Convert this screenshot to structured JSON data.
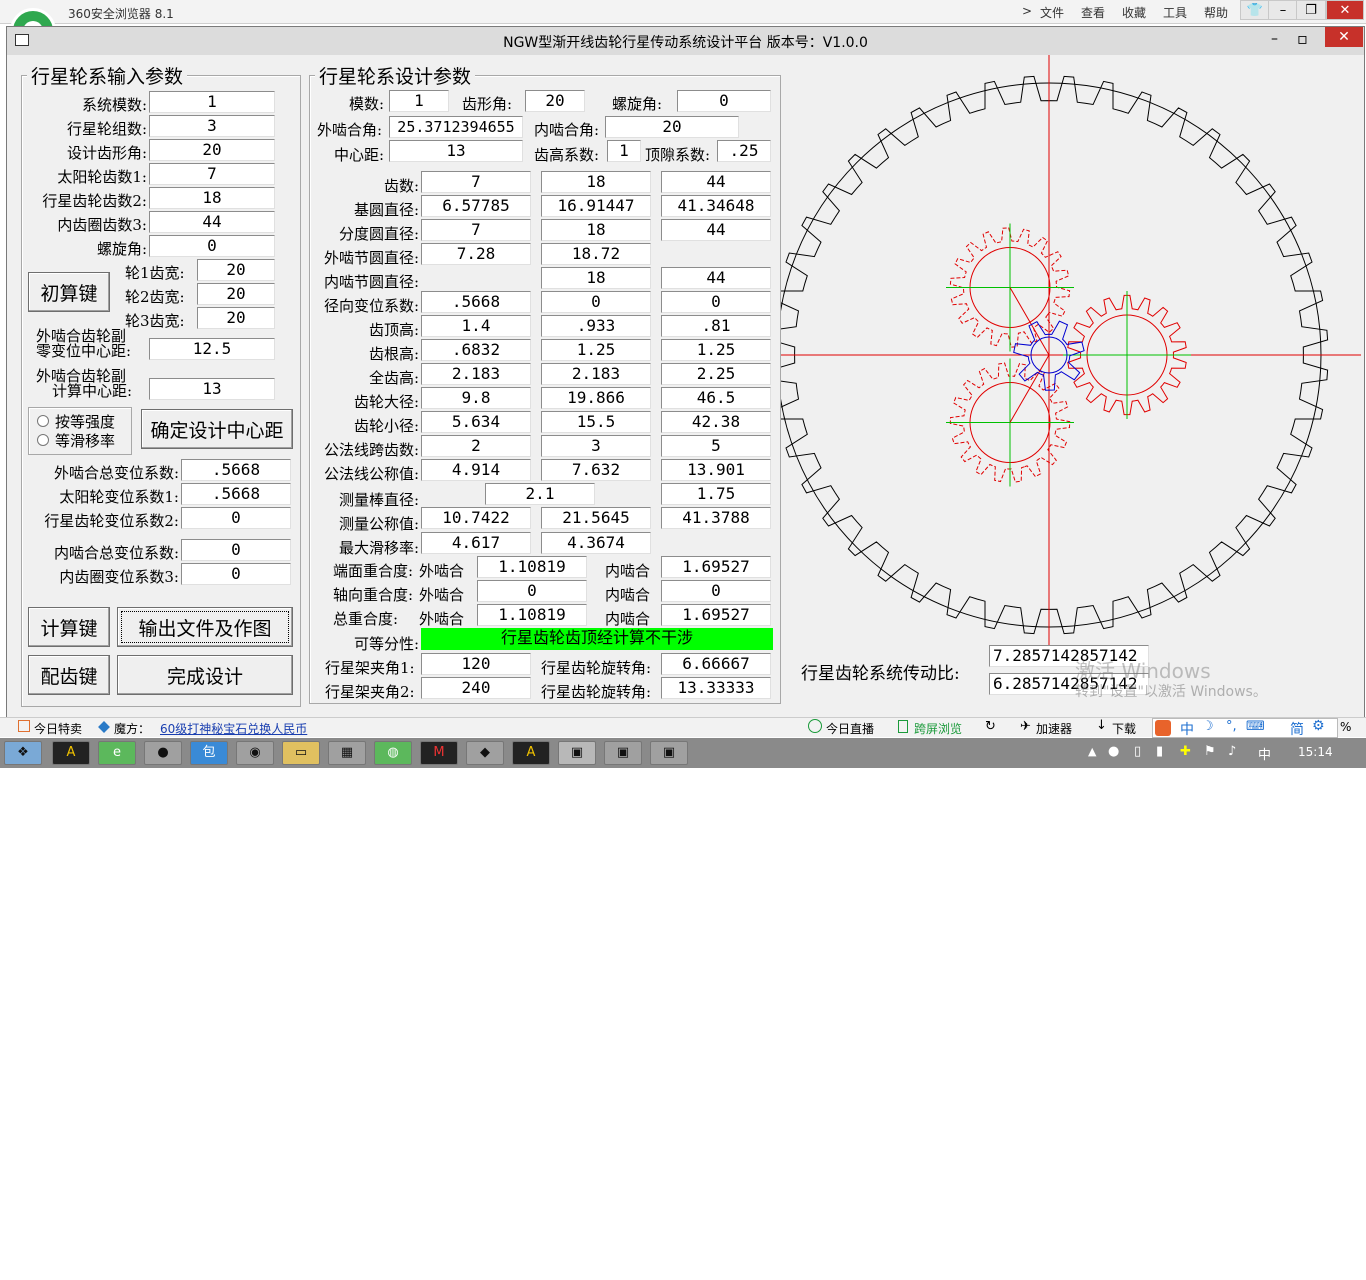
{
  "browser": {
    "title": "360安全浏览器 8.1",
    "menu": [
      "文件",
      "查看",
      "收藏",
      "工具",
      "帮助"
    ],
    "chevron": ">"
  },
  "window": {
    "title": "NGW型渐开线齿轮行星传动系统设计平台   版本号：V1.0.0",
    "min": "–",
    "max": "▫",
    "close": "✕"
  },
  "input_panel": {
    "title": "行星轮系输入参数",
    "rows": [
      {
        "label": "系统模数:",
        "value": "1"
      },
      {
        "label": "行星轮组数:",
        "value": "3"
      },
      {
        "label": "设计齿形角:",
        "value": "20"
      },
      {
        "label": "太阳轮齿数1:",
        "value": "7"
      },
      {
        "label": "行星齿轮齿数2:",
        "value": "18"
      },
      {
        "label": "内齿圈齿数3:",
        "value": "44"
      },
      {
        "label": "螺旋角:",
        "value": "0"
      }
    ],
    "initial_calc_button": "初算键",
    "widths": [
      {
        "label": "轮1齿宽:",
        "value": "20"
      },
      {
        "label": "轮2齿宽:",
        "value": "20"
      },
      {
        "label": "轮3齿宽:",
        "value": "20"
      }
    ],
    "zero_shift_label_1": "外啮合齿轮副",
    "zero_shift_label_2": "零变位中心距:",
    "zero_shift_value": "12.5",
    "calc_center_label_1": "外啮合齿轮副",
    "calc_center_label_2": "计算中心距:",
    "calc_center_value": "13",
    "radio_equal_strength": "按等强度",
    "radio_equal_slip": "等滑移率",
    "confirm_center_button": "确定设计中心距",
    "shift_rows": [
      {
        "label": "外啮合总变位系数:",
        "value": ".5668"
      },
      {
        "label": "太阳轮变位系数1:",
        "value": ".5668"
      },
      {
        "label": "行星齿轮变位系数2:",
        "value": "0"
      }
    ],
    "inner_rows": [
      {
        "label": "内啮合总变位系数:",
        "value": "0"
      },
      {
        "label": "内齿圈变位系数3:",
        "value": "0"
      }
    ],
    "calc_button": "计算键",
    "output_button": "输出文件及作图",
    "match_button": "配齿键",
    "finish_button": "完成设计"
  },
  "design_panel": {
    "title": "行星轮系设计参数",
    "module_label": "模数:",
    "module": "1",
    "profile_angle_label": "齿形角:",
    "profile_angle": "20",
    "helix_label": "螺旋角:",
    "helix": "0",
    "ext_mesh_angle_label": "外啮合角:",
    "ext_mesh_angle": "25.3712394655",
    "int_mesh_angle_label": "内啮合角:",
    "int_mesh_angle": "20",
    "center_label": "中心距:",
    "center": "13",
    "addendum_coef_label": "齿高系数:",
    "addendum_coef": "1",
    "clearance_label": "顶隙系数:",
    "clearance": ".25",
    "table": [
      {
        "label": "齿数:",
        "v": [
          "7",
          "18",
          "44"
        ]
      },
      {
        "label": "基圆直径:",
        "v": [
          "6.57785",
          "16.91447",
          "41.34648"
        ]
      },
      {
        "label": "分度圆直径:",
        "v": [
          "7",
          "18",
          "44"
        ]
      },
      {
        "label": "外啮节圆直径:",
        "v": [
          "7.28",
          "18.72",
          ""
        ]
      },
      {
        "label": "内啮节圆直径:",
        "v": [
          "",
          "18",
          "44"
        ]
      },
      {
        "label": "径向变位系数:",
        "v": [
          ".5668",
          "0",
          "0"
        ]
      },
      {
        "label": "齿顶高:",
        "v": [
          "1.4",
          ".933",
          ".81"
        ]
      },
      {
        "label": "齿根高:",
        "v": [
          ".6832",
          "1.25",
          "1.25"
        ]
      },
      {
        "label": "全齿高:",
        "v": [
          "2.183",
          "2.183",
          "2.25"
        ]
      },
      {
        "label": "齿轮大径:",
        "v": [
          "9.8",
          "19.866",
          "46.5"
        ]
      },
      {
        "label": "齿轮小径:",
        "v": [
          "5.634",
          "15.5",
          "42.38"
        ]
      },
      {
        "label": "公法线跨齿数:",
        "v": [
          "2",
          "3",
          "5"
        ]
      },
      {
        "label": "公法线公称值:",
        "v": [
          "4.914",
          "7.632",
          "13.901"
        ]
      }
    ],
    "rod_label": "测量棒直径:",
    "rod_12": "2.1",
    "rod_3": "1.75",
    "measure_label": "测量公称值:",
    "measure": [
      "10.7422",
      "21.5645",
      "41.3788"
    ],
    "slip_label": "最大滑移率:",
    "slip": [
      "4.617",
      "4.3674"
    ],
    "contact_rows": [
      {
        "label": "端面重合度:",
        "ext": "外啮合",
        "ext_v": "1.10819",
        "int": "内啮合",
        "int_v": "1.69527"
      },
      {
        "label": "轴向重合度:",
        "ext": "外啮合",
        "ext_v": "0",
        "int": "内啮合",
        "int_v": "0"
      },
      {
        "label": "总重合度:",
        "ext": "外啮合",
        "ext_v": "1.10819",
        "int": "内啮合",
        "int_v": "1.69527"
      }
    ],
    "assembly_label": "可等分性:",
    "assembly_status": "行星齿轮齿顶经计算不干涉",
    "carrier1_label": "行星架夹角1:",
    "carrier1": "120",
    "rotate1_label": "行星齿轮旋转角:",
    "rotate1": "6.66667",
    "carrier2_label": "行星架夹角2:",
    "carrier2": "240",
    "rotate2_label": "行星齿轮旋转角:",
    "rotate2": "13.33333"
  },
  "ratio": {
    "label": "行星齿轮系统传动比:",
    "value1": "7.2857142857142",
    "value2": "6.2857142857142"
  },
  "watermark": {
    "line1": "激活 Windows",
    "line2": "转到\"设置\"以激活 Windows。"
  },
  "gear_drawing": {
    "ring_teeth": 44,
    "planet_teeth": 18,
    "sun_teeth": 7,
    "planet_count": 3,
    "colors": {
      "ring": "#000000",
      "planet": "#e00000",
      "sun": "#0000d0",
      "axis": "#e00000",
      "center_lines": "#00c000"
    }
  },
  "status_bar": {
    "items": [
      "今日特卖",
      "魔方：",
      "60级打神秘宝石兑换人民币",
      "今日直播",
      "跨屏浏览",
      "加速器",
      "下载"
    ],
    "ime": [
      "中",
      "简"
    ],
    "zoom": "%"
  },
  "taskbar": {
    "clock": "15:14",
    "ime": "中"
  }
}
